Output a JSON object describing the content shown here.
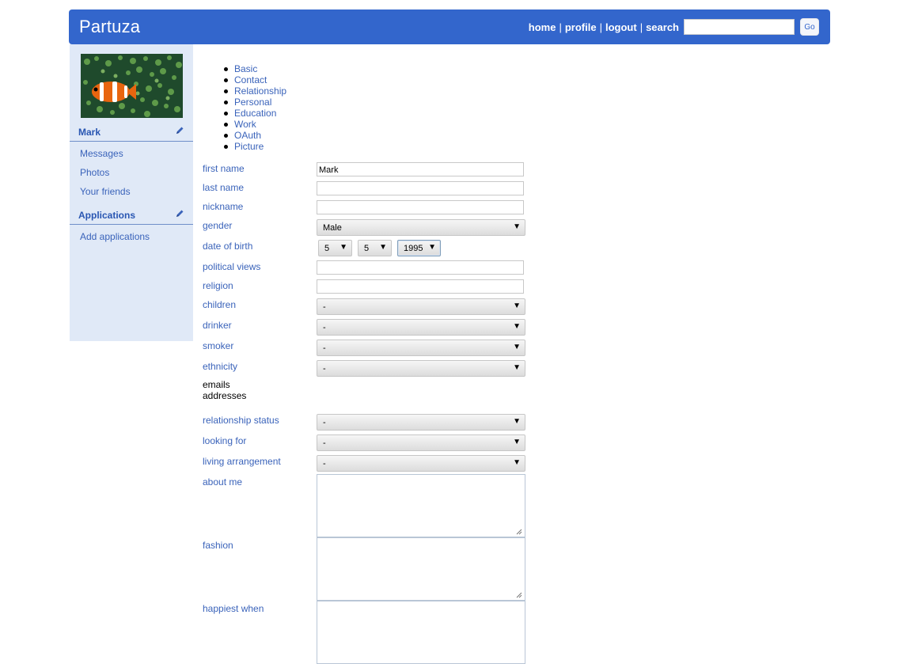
{
  "header": {
    "logo": "Partuza",
    "nav": {
      "home": "home",
      "profile": "profile",
      "logout": "logout",
      "search": "search"
    },
    "sep": "|",
    "search_value": "",
    "go_label": "Go"
  },
  "sidebar": {
    "user_name": "Mark",
    "links": [
      "Messages",
      "Photos",
      "Your friends"
    ],
    "apps_heading": "Applications",
    "apps_links": [
      "Add applications"
    ]
  },
  "tabs": [
    "Basic",
    "Contact",
    "Relationship",
    "Personal",
    "Education",
    "Work",
    "OAuth",
    "Picture"
  ],
  "form": {
    "first_name": {
      "label": "first name",
      "value": "Mark"
    },
    "last_name": {
      "label": "last name",
      "value": ""
    },
    "nickname": {
      "label": "nickname",
      "value": ""
    },
    "gender": {
      "label": "gender",
      "value": "Male"
    },
    "dob": {
      "label": "date of birth",
      "day": "5",
      "month": "5",
      "year": "1995"
    },
    "political_views": {
      "label": "political views",
      "value": ""
    },
    "religion": {
      "label": "religion",
      "value": ""
    },
    "children": {
      "label": "children",
      "value": "-"
    },
    "drinker": {
      "label": "drinker",
      "value": "-"
    },
    "smoker": {
      "label": "smoker",
      "value": "-"
    },
    "ethnicity": {
      "label": "ethnicity",
      "value": "-"
    },
    "emails": {
      "label_line1": "emails",
      "label_line2": "addresses"
    },
    "relationship_status": {
      "label": "relationship status",
      "value": "-"
    },
    "looking_for": {
      "label": "looking for",
      "value": "-"
    },
    "living_arrangement": {
      "label": "living arrangement",
      "value": "-"
    },
    "about_me": {
      "label": "about me",
      "value": ""
    },
    "fashion": {
      "label": "fashion",
      "value": ""
    },
    "happiest_when": {
      "label": "happiest when",
      "value": ""
    }
  },
  "icons": {
    "dropdown_arrow": "▼",
    "edit": "pencil-icon"
  },
  "colors": {
    "brand": "#3366cc",
    "sidebar_bg": "#e0e9f7",
    "link": "#3a63ba"
  }
}
